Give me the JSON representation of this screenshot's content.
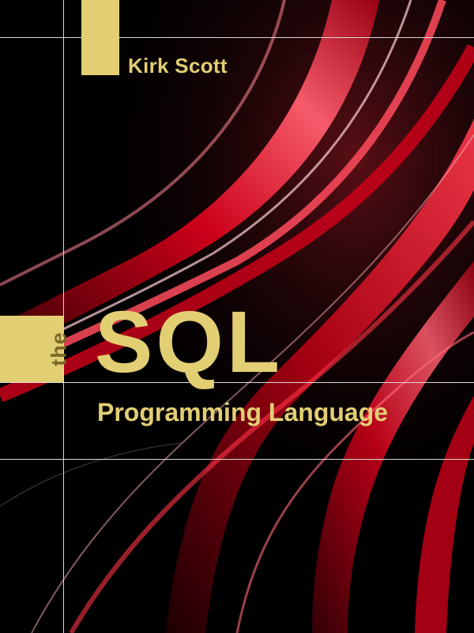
{
  "cover": {
    "author": "Kirk Scott",
    "title_prefix": "the",
    "title_main": "SQL",
    "subtitle": "Programming Language"
  },
  "colors": {
    "background": "#000000",
    "accent_gold": "#e2ce73",
    "swirl_red": "#e0001a",
    "guide_lines": "#d9d9d9"
  }
}
